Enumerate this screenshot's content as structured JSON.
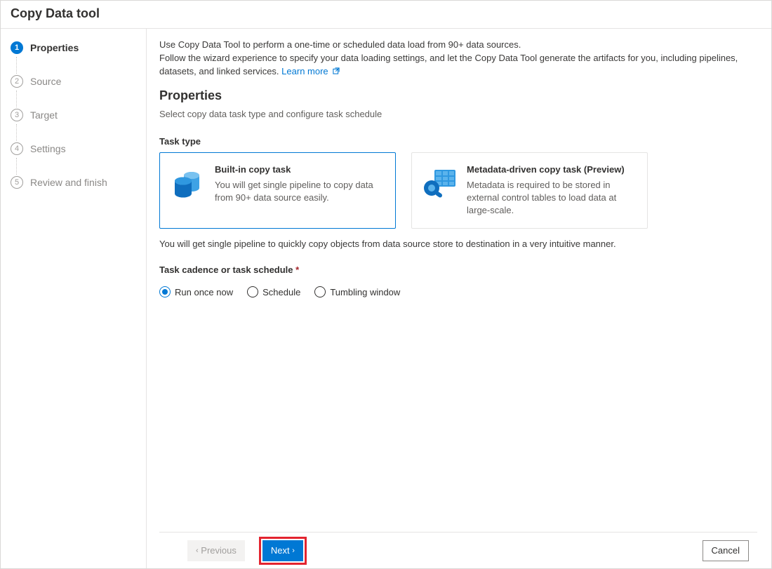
{
  "title": "Copy Data tool",
  "sidebar": {
    "items": [
      {
        "num": "1",
        "label": "Properties",
        "active": true
      },
      {
        "num": "2",
        "label": "Source"
      },
      {
        "num": "3",
        "label": "Target"
      },
      {
        "num": "4",
        "label": "Settings"
      },
      {
        "num": "5",
        "label": "Review and finish"
      }
    ]
  },
  "intro": {
    "line1": "Use Copy Data Tool to perform a one-time or scheduled data load from 90+ data sources.",
    "line2": "Follow the wizard experience to specify your data loading settings, and let the Copy Data Tool generate the artifacts for you, including pipelines, datasets, and linked services.",
    "learn_more": "Learn more"
  },
  "section_title": "Properties",
  "section_sub": "Select copy data task type and configure task schedule",
  "task_type": {
    "label": "Task type",
    "card1": {
      "title": "Built-in copy task",
      "desc": "You will get single pipeline to copy data from 90+ data source easily."
    },
    "card2": {
      "title": "Metadata-driven copy task (Preview)",
      "desc": "Metadata is required to be stored in external control tables to load data at large-scale."
    },
    "note": "You will get single pipeline to quickly copy objects from data source store to destination in a very intuitive manner."
  },
  "schedule": {
    "label": "Task cadence or task schedule",
    "options": {
      "run_once": "Run once now",
      "schedule": "Schedule",
      "tumbling": "Tumbling window"
    }
  },
  "footer": {
    "previous": "Previous",
    "next": "Next",
    "cancel": "Cancel"
  }
}
